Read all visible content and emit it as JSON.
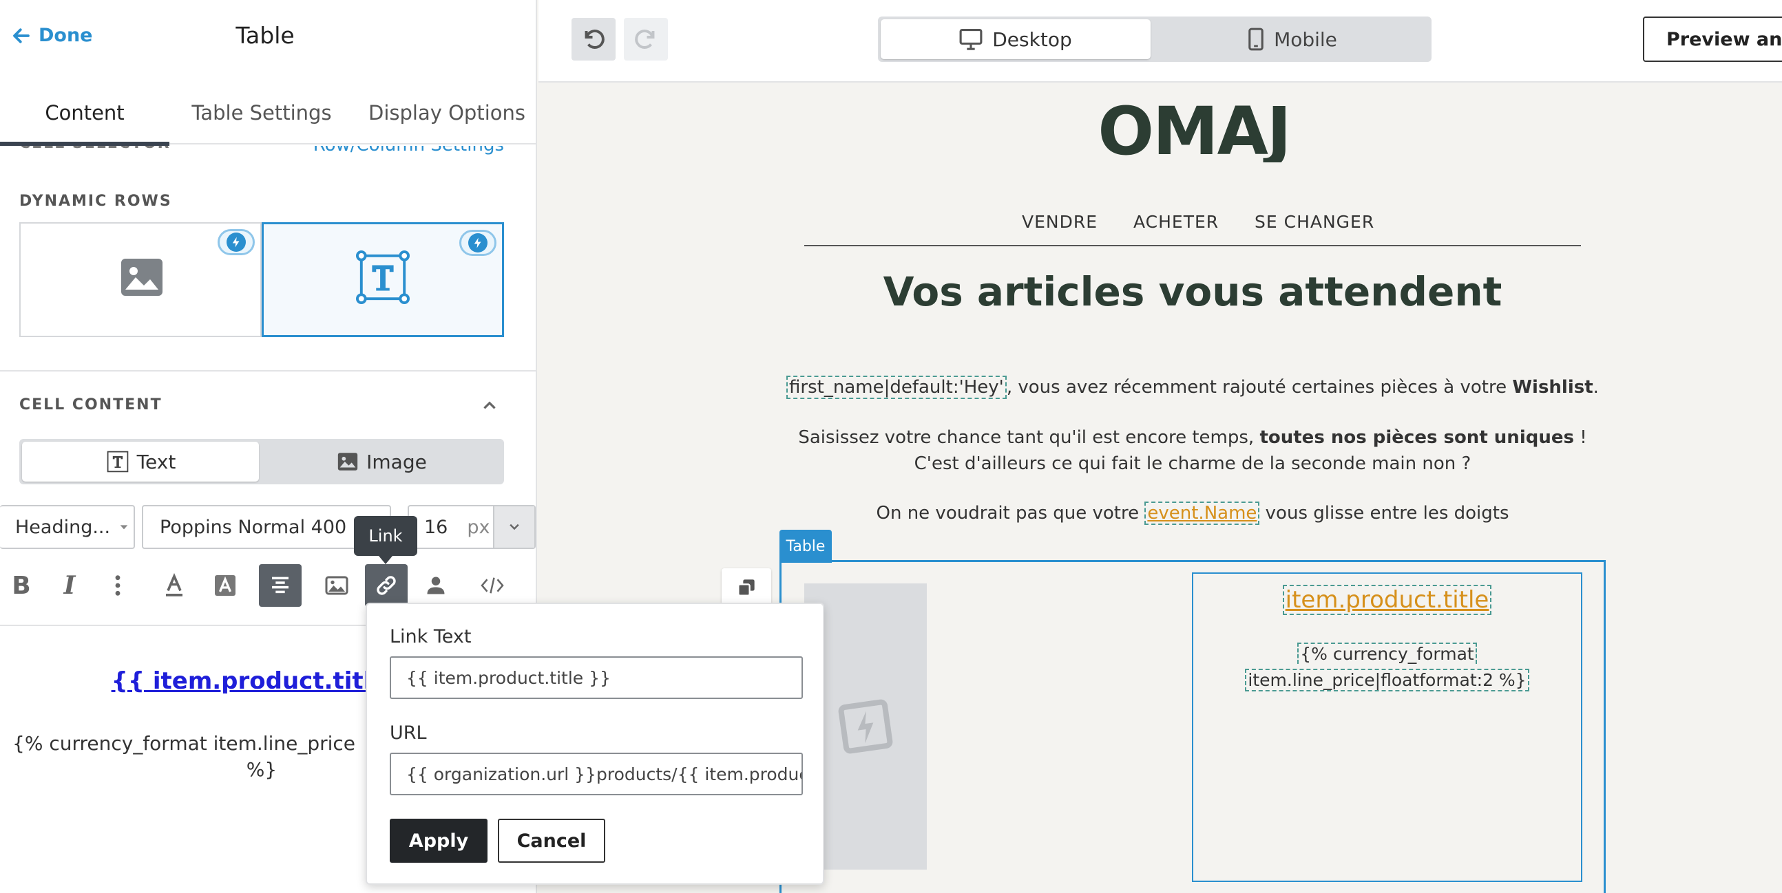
{
  "left_panel": {
    "done_label": "Done",
    "title": "Table",
    "tabs": [
      {
        "label": "Content",
        "active": true
      },
      {
        "label": "Table Settings",
        "active": false
      },
      {
        "label": "Display Options",
        "active": false
      }
    ],
    "cell_selector_label": "CELL SELECTOR",
    "row_column_settings": "Row/Column Settings",
    "dynamic_rows_label": "DYNAMIC ROWS",
    "cell_content_label": "CELL CONTENT",
    "content_types": [
      {
        "label": "Text",
        "active": true
      },
      {
        "label": "Image",
        "active": false
      }
    ],
    "style_select": "Heading...",
    "font_select": "Poppins Normal 400",
    "font_size": "16",
    "font_unit": "px",
    "tooltip": "Link",
    "preview": {
      "link_text": "{{ item.product.title",
      "currency_line1": "{% currency_format item.line_price",
      "currency_line2": "%}"
    }
  },
  "link_popup": {
    "link_text_label": "Link Text",
    "link_text_value": "{{ item.product.title }}",
    "url_label": "URL",
    "url_value": "{{ organization.url }}products/{{ item.product.h",
    "apply_label": "Apply",
    "cancel_label": "Cancel"
  },
  "topbar": {
    "devices": [
      {
        "label": "Desktop",
        "active": true
      },
      {
        "label": "Mobile",
        "active": false
      }
    ],
    "preview_button": "Preview and T"
  },
  "email": {
    "logo": "OMAJ",
    "nav": [
      "VENDRE",
      "ACHETER",
      "SE CHANGER"
    ],
    "headline": "Vos articles vous attendent",
    "p1_var": "first_name|default:'Hey'",
    "p1_text": ", vous avez récemment rajouté certaines pièces à votre ",
    "p1_bold": "Wishlist",
    "p1_end": ".",
    "p2_text": "Saisissez votre chance tant qu'il est encore temps, ",
    "p2_bold": "toutes nos pièces sont uniques",
    "p2_end": " !",
    "p3_text": "C'est d'ailleurs ce qui fait le charme de la seconde main non ?",
    "p4_start": "On ne voudrait pas que votre ",
    "p4_var": "event.Name",
    "p4_end": " vous glisse entre les doigts",
    "table_tag": "Table",
    "item_title": "item.product.title",
    "item_price_line1": "{% currency_format",
    "item_price_line2": "item.line_price|floatformat:2 %}"
  },
  "colors": {
    "accent": "#2a8fcf",
    "headline": "#2c3d33",
    "link_orange": "#d6901b",
    "dark_button": "#232629"
  }
}
